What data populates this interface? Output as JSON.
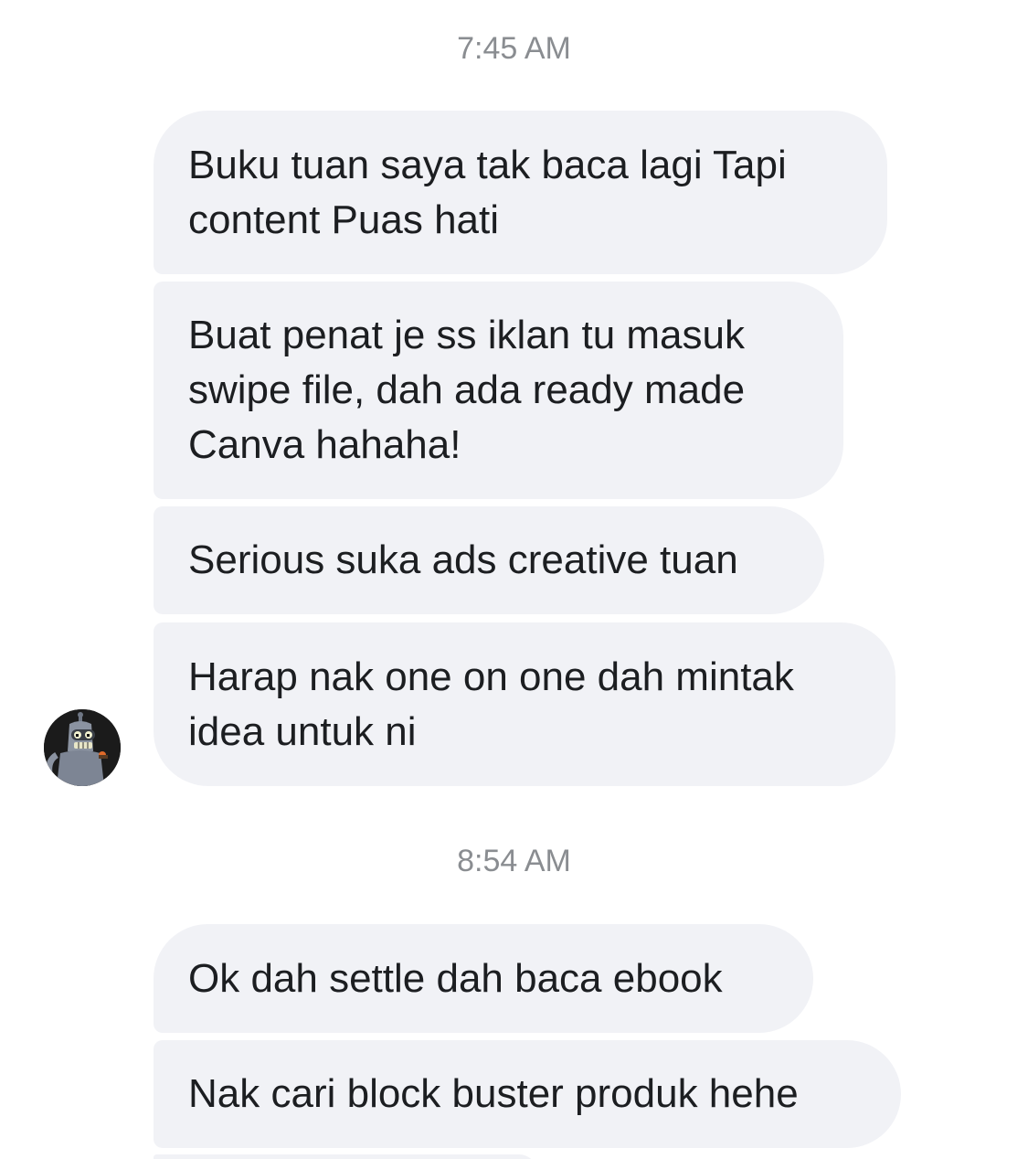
{
  "conversation": {
    "groups": [
      {
        "time": "7:45 AM",
        "messages": [
          "Buku tuan saya tak baca lagi Tapi content Puas hati",
          "Buat penat je ss iklan tu masuk swipe file, dah ada ready made Canva hahaha!",
          "Serious suka ads creative tuan",
          "Harap nak one on one dah mintak idea untuk ni"
        ]
      },
      {
        "time": "8:54 AM",
        "messages": [
          "Ok dah settle dah baca ebook",
          "Nak cari block buster produk hehe"
        ]
      }
    ]
  },
  "sender": {
    "avatar_icon": "robot-avatar-icon"
  },
  "colors": {
    "bubble_bg": "#f1f2f6",
    "text": "#1c1e21",
    "timestamp": "#8a8d91"
  }
}
